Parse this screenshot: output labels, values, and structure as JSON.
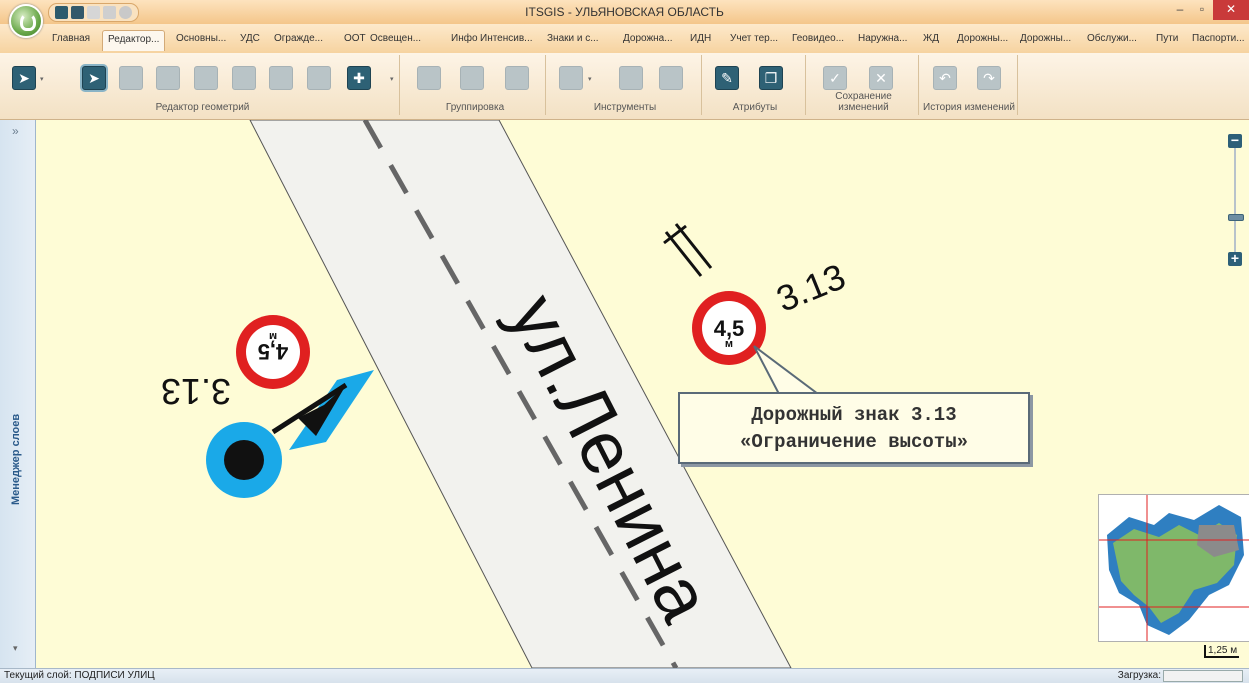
{
  "window": {
    "title": "ITSGIS - УЛЬЯНОВСКАЯ ОБЛАСТЬ",
    "controls": {
      "minimize": "–",
      "restore": "▫",
      "close": "✕"
    }
  },
  "tabs": [
    {
      "label": "Главная",
      "active": false
    },
    {
      "label": "Редактор...",
      "active": true
    },
    {
      "label": "Основны...",
      "active": false
    },
    {
      "label": "УДС",
      "active": false
    },
    {
      "label": "Огражде...",
      "active": false
    },
    {
      "label": "ООТ",
      "active": false
    },
    {
      "label": "Освещен...",
      "active": false
    },
    {
      "label": "Инфо",
      "active": false
    },
    {
      "label": "Интенсив...",
      "active": false
    },
    {
      "label": "Знаки и с...",
      "active": false
    },
    {
      "label": "Дорожна...",
      "active": false
    },
    {
      "label": "ИДН",
      "active": false
    },
    {
      "label": "Учет тер...",
      "active": false
    },
    {
      "label": "Геовидео...",
      "active": false
    },
    {
      "label": "Наружна...",
      "active": false
    },
    {
      "label": "ЖД",
      "active": false
    },
    {
      "label": "Дорожны...",
      "active": false
    },
    {
      "label": "Дорожны...",
      "active": false
    },
    {
      "label": "Обслужи...",
      "active": false
    },
    {
      "label": "Пути",
      "active": false
    },
    {
      "label": "Паспорти...",
      "active": false
    }
  ],
  "ribbon": {
    "groups": [
      {
        "label": "Редактор геометрий"
      },
      {
        "label": "Группировка"
      },
      {
        "label": "Инструменты"
      },
      {
        "label": "Атрибуты"
      },
      {
        "label": "Сохранение изменений"
      },
      {
        "label": "История изменений"
      }
    ]
  },
  "left_panel": {
    "label": "Менеджер слоев",
    "expand": "»",
    "collapse": "▾"
  },
  "map": {
    "street_label": "ул.Ленина",
    "sign_left": {
      "code": "3.13",
      "height_value": "4,5",
      "unit": "м"
    },
    "sign_right": {
      "code": "3.13",
      "height_value": "4,5",
      "unit": "м"
    },
    "callout": {
      "line1": "Дорожный знак 3.13",
      "line2": "«Ограничение высоты»"
    },
    "zoom": {
      "minus": "−",
      "plus": "+",
      "level": 0.6
    },
    "scale_label": "1,25 м",
    "colors": {
      "background": "#fefcd6",
      "road": "#f2f2ee",
      "selection": "#1aa9e8",
      "sign_border": "#e02020"
    }
  },
  "statusbar": {
    "current_layer": "Текущий слой: ПОДПИСИ УЛИЦ",
    "loading_label": "Загрузка:"
  }
}
